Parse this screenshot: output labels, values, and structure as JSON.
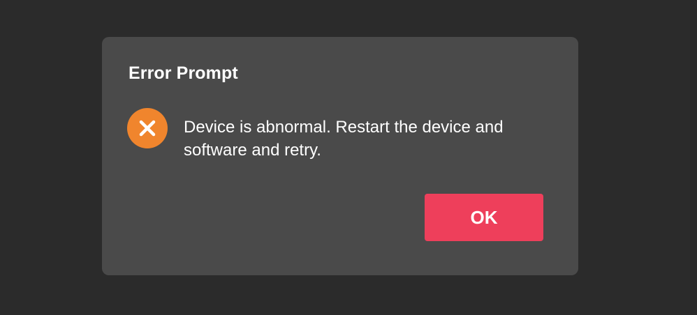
{
  "dialog": {
    "title": "Error Prompt",
    "icon": "error-x-icon",
    "message": "Device is abnormal. Restart the device and software and retry.",
    "ok_label": "OK"
  },
  "colors": {
    "backdrop": "#2b2b2b",
    "dialog_background": "#4a4a4a",
    "icon_background": "#f0852d",
    "button_background": "#ee3f5b",
    "text": "#ffffff"
  }
}
